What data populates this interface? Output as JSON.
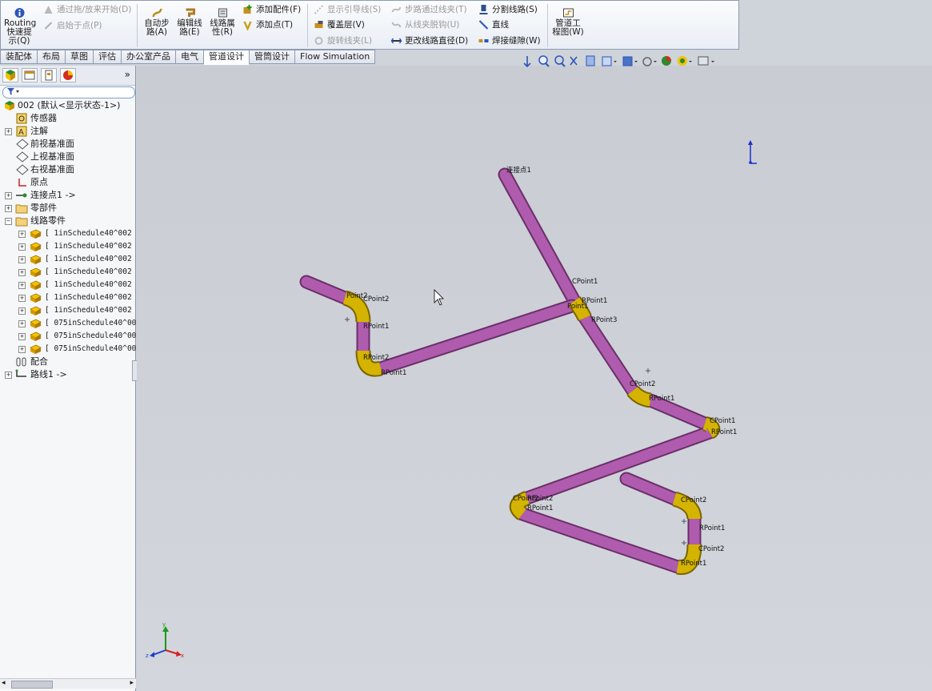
{
  "ribbon": {
    "routing": "Routing",
    "quick_tip_1": "快速提",
    "quick_tip_2": "示(Q)",
    "drag_start": "通过拖/放来开始(D)",
    "start_at_point": "启始于点(P)",
    "auto_route_1": "自动步",
    "auto_route_2": "路(A)",
    "edit_route_1": "编辑线",
    "edit_route_2": "路(E)",
    "route_props_1": "线路属",
    "route_props_2": "性(R)",
    "add_fitting": "添加配件(F)",
    "add_point": "添加点(T)",
    "show_guidelines": "显示引导线(S)",
    "cover": "覆盖层(V)",
    "rotate_clip": "旋转线夹(L)",
    "route_through_clip": "步路通过线夹(T)",
    "unclip": "从线夹脱钩(U)",
    "change_diameter": "更改线路直径(D)",
    "split_route": "分割线路(S)",
    "line": "直线",
    "weld_gap": "焊接缝隙(W)",
    "pipe_drawing_1": "管道工",
    "pipe_drawing_2": "程图(W)"
  },
  "tabs": [
    "装配体",
    "布局",
    "草图",
    "评估",
    "办公室产品",
    "电气",
    "管道设计",
    "管筒设计",
    "Flow Simulation"
  ],
  "active_tab": "管道设计",
  "panel": {
    "collapse": "»",
    "tree": {
      "root": "002  (默认<显示状态-1>)",
      "sensors": "传感器",
      "annotations": "注解",
      "front_plane": "前视基准面",
      "top_plane": "上视基准面",
      "right_plane": "右视基准面",
      "origin": "原点",
      "connection_point": "连接点1 ->",
      "parts": "零部件",
      "route_parts": "线路零件",
      "route_items": [
        "[ 1inSchedule40^002 ]",
        "[ 1inSchedule40^002 ]",
        "[ 1inSchedule40^002 ]",
        "[ 1inSchedule40^002 ]",
        "[ 1inSchedule40^002 ]",
        "[ 1inSchedule40^002 ]",
        "[ 1inSchedule40^002 ]",
        "[ 075inSchedule40^002",
        "[ 075inSchedule40^002",
        "[ 075inSchedule40^002"
      ],
      "mates": "配合",
      "route": "路线1 ->"
    }
  },
  "viewport": {
    "label_connection": "连接点1",
    "point_labels": [
      "CPoint1",
      "RPoint1",
      "Point1",
      "RPoint3",
      "CPoint2",
      "RPoint1",
      "CPoint2",
      "RPoint1",
      "RPoint2",
      "CPoint1",
      "RPoint1",
      "RPoint2",
      "RPoint1",
      "CPoint2",
      "RPoint1",
      "CPoint2",
      "RPoint1",
      "CPoint2",
      "RPoint1",
      "Point2"
    ],
    "axis_x": "x",
    "axis_y": "y",
    "axis_z": "z",
    "pipe_color": "#b05cae",
    "elbow_color": "#d4b400"
  }
}
